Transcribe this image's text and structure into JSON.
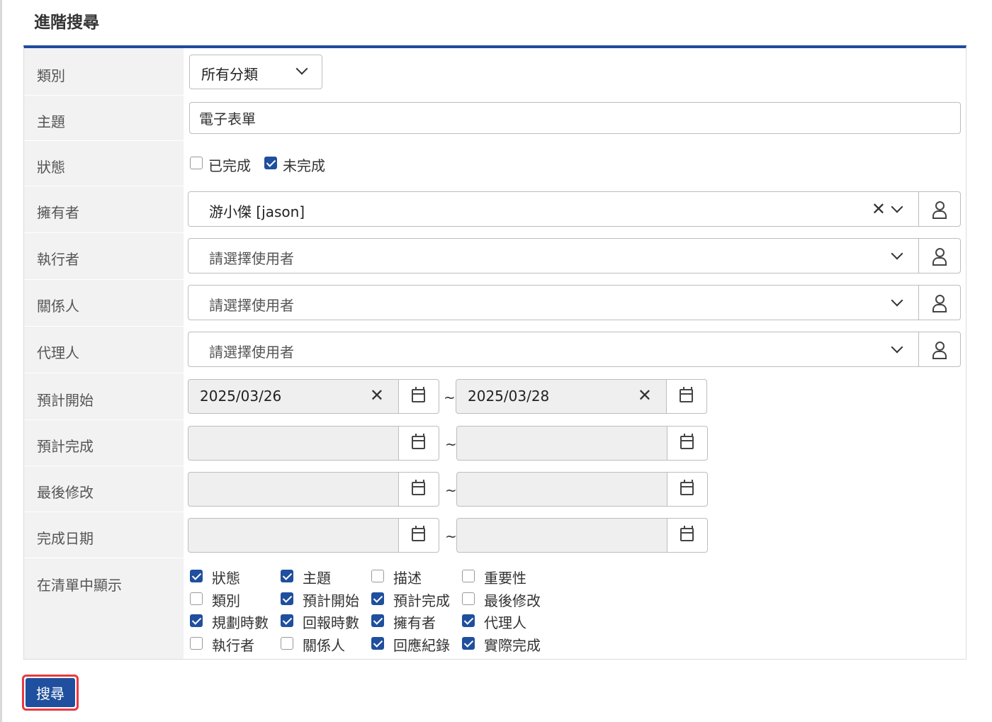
{
  "title": "進階搜尋",
  "labels": {
    "category": "類別",
    "subject": "主題",
    "status": "狀態",
    "owner": "擁有者",
    "executor": "執行者",
    "related": "關係人",
    "proxy": "代理人",
    "planned_start": "預計開始",
    "planned_finish": "預計完成",
    "last_modified": "最後修改",
    "completed_date": "完成日期",
    "show_in_list": "在清單中顯示"
  },
  "category": {
    "selected": "所有分類"
  },
  "subject": {
    "value": "電子表單"
  },
  "status": {
    "options": [
      {
        "label": "已完成",
        "checked": false
      },
      {
        "label": "未完成",
        "checked": true
      }
    ]
  },
  "owner": {
    "value": "游小傑 [jason]"
  },
  "executor": {
    "placeholder": "請選擇使用者"
  },
  "related": {
    "placeholder": "請選擇使用者"
  },
  "proxy": {
    "placeholder": "請選擇使用者"
  },
  "planned_start": {
    "from": "2025/03/26",
    "to": "2025/03/28"
  },
  "planned_finish": {
    "from": "",
    "to": ""
  },
  "last_modified": {
    "from": "",
    "to": ""
  },
  "completed_date": {
    "from": "",
    "to": ""
  },
  "range_separator": "~",
  "columns": [
    {
      "label": "狀態",
      "checked": true
    },
    {
      "label": "主題",
      "checked": true
    },
    {
      "label": "描述",
      "checked": false
    },
    {
      "label": "重要性",
      "checked": false
    },
    {
      "label": "類別",
      "checked": false
    },
    {
      "label": "預計開始",
      "checked": true
    },
    {
      "label": "預計完成",
      "checked": true
    },
    {
      "label": "最後修改",
      "checked": false
    },
    {
      "label": "規劃時數",
      "checked": true
    },
    {
      "label": "回報時數",
      "checked": true
    },
    {
      "label": "擁有者",
      "checked": true
    },
    {
      "label": "代理人",
      "checked": true
    },
    {
      "label": "執行者",
      "checked": false
    },
    {
      "label": "關係人",
      "checked": false
    },
    {
      "label": "回應紀錄",
      "checked": true
    },
    {
      "label": "實際完成",
      "checked": true
    }
  ],
  "search_button": "搜尋",
  "icons": {
    "dropdown": "chevron-down-icon",
    "clear": "close-icon",
    "user": "user-icon",
    "calendar": "calendar-icon"
  },
  "colors": {
    "accent": "#1e4b9e",
    "button_bg": "#1f4f9e",
    "highlight": "#e8393f"
  }
}
